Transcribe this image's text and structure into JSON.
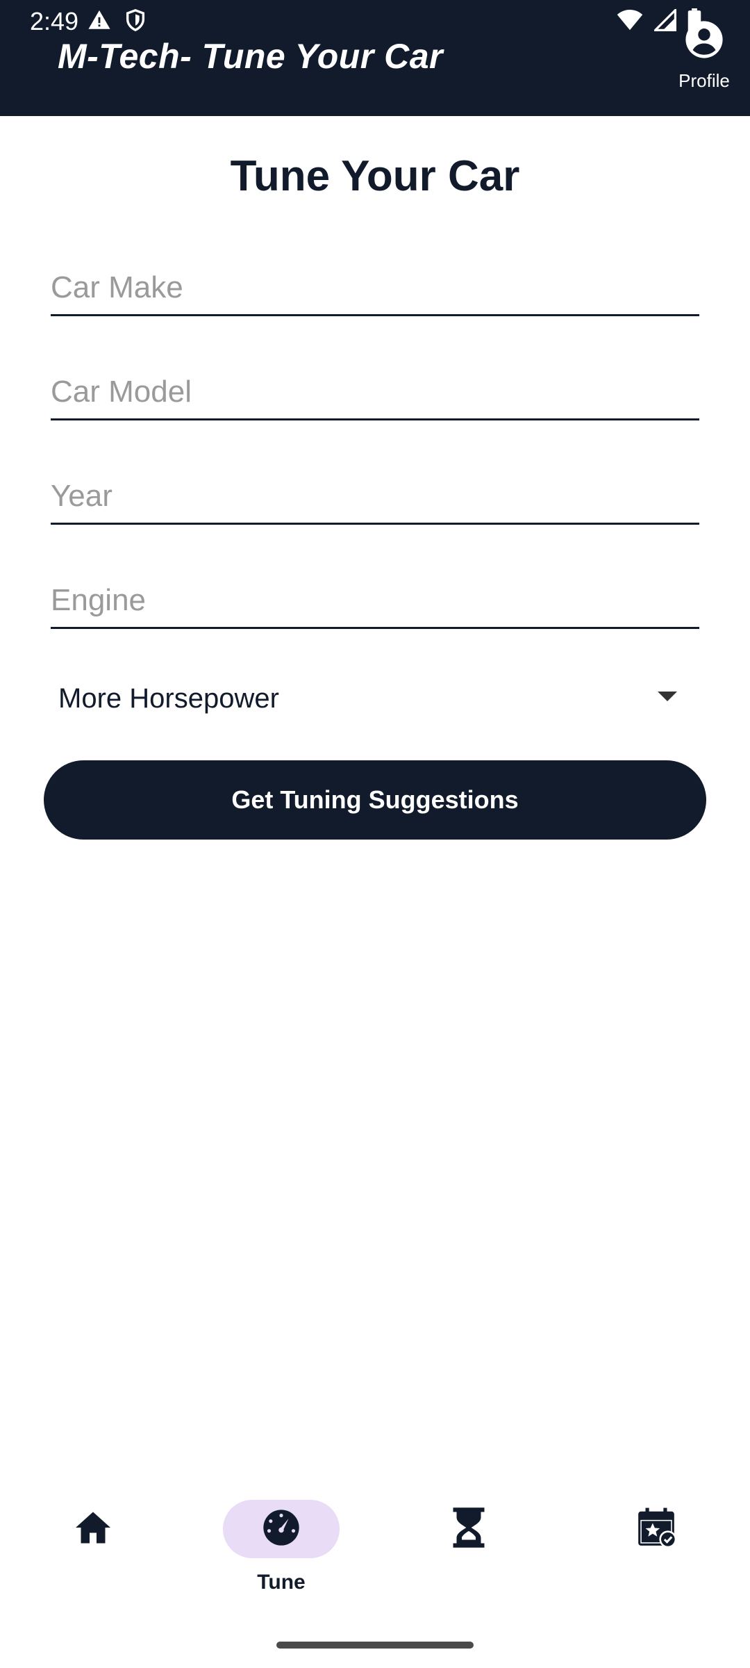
{
  "status_bar": {
    "time": "2:49",
    "left_icons": [
      "warning-icon",
      "shield-icon"
    ],
    "right_icons": [
      "wifi-icon",
      "signal-icon",
      "battery-icon"
    ]
  },
  "header": {
    "title": "M-Tech- Tune Your Car",
    "profile_label": "Profile"
  },
  "main": {
    "title": "Tune Your Car",
    "fields": [
      {
        "placeholder": "Car Make",
        "value": ""
      },
      {
        "placeholder": "Car Model",
        "value": ""
      },
      {
        "placeholder": "Year",
        "value": ""
      },
      {
        "placeholder": "Engine",
        "value": ""
      }
    ],
    "goal_select": {
      "selected": "More Horsepower"
    },
    "submit_label": "Get Tuning Suggestions"
  },
  "bottom_nav": {
    "items": [
      {
        "icon": "home-icon",
        "label": "",
        "active": false
      },
      {
        "icon": "speedometer-icon",
        "label": "Tune",
        "active": true
      },
      {
        "icon": "hourglass-icon",
        "label": "",
        "active": false
      },
      {
        "icon": "calendar-star-icon",
        "label": "",
        "active": false
      }
    ]
  },
  "colors": {
    "primary": "#111b2b",
    "active_pill": "#e8dcf6",
    "placeholder": "#9a9a9a",
    "background": "#ffffff"
  }
}
